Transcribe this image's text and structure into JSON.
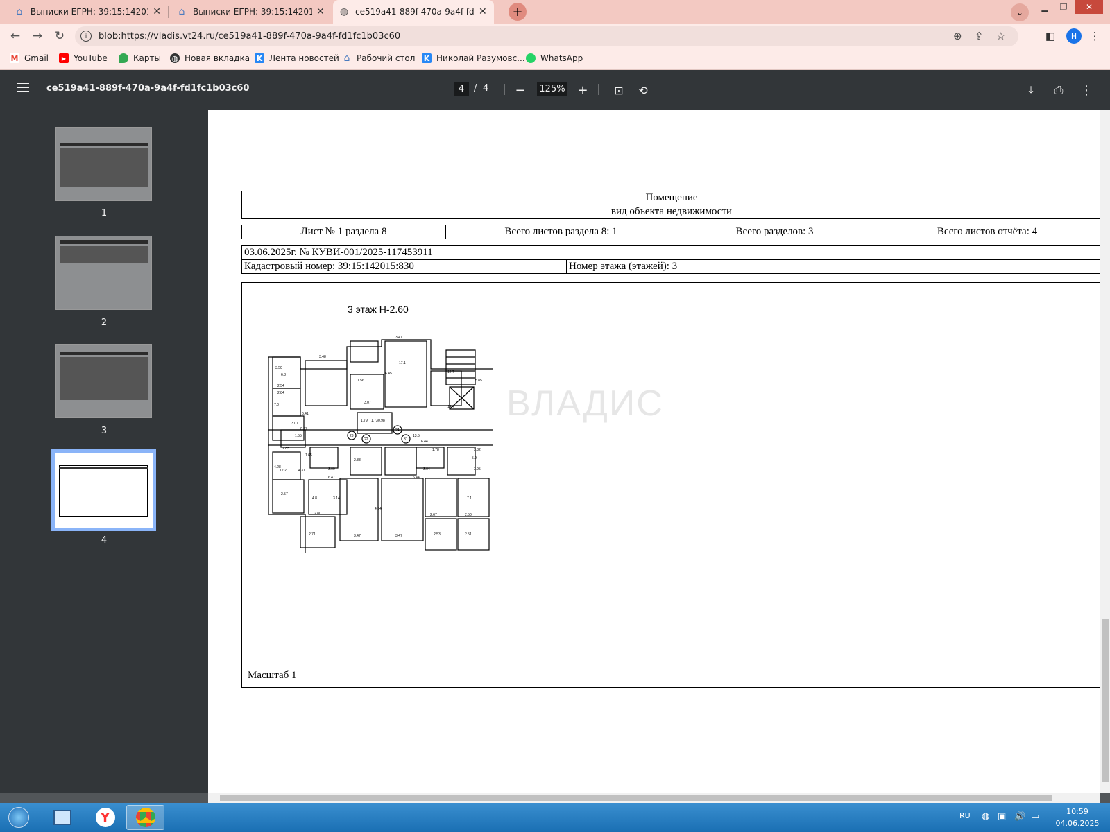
{
  "browser": {
    "tabs": [
      {
        "title": "Выписки ЕГРН: 39:15:142015:830",
        "close": "✕",
        "active": false
      },
      {
        "title": "Выписки ЕГРН: 39:15:142015:830",
        "close": "✕",
        "active": false
      },
      {
        "title": "ce519a41-889f-470a-9a4f-fd1fc1b03c60",
        "close": "✕",
        "active": true
      }
    ],
    "new_tab": "+",
    "url": "blob:https://vladis.vt24.ru/ce519a41-889f-470a-9a4f-fd1fc1b03c60",
    "profile_initial": "Н",
    "bookmarks": [
      {
        "label": "Gmail",
        "icon": "gmail-icon",
        "color": "#ea4335",
        "glyph": "M"
      },
      {
        "label": "YouTube",
        "icon": "youtube-icon",
        "color": "#ff0000",
        "glyph": "▶"
      },
      {
        "label": "Карты",
        "icon": "maps-icon",
        "color": "#34a853",
        "glyph": "●"
      },
      {
        "label": "Новая вкладка",
        "icon": "globe-icon",
        "color": "#444444",
        "glyph": "◍"
      },
      {
        "label": "Лента новостей",
        "icon": "vk-icon",
        "color": "#2787f5",
        "glyph": "K"
      },
      {
        "label": "Рабочий стол",
        "icon": "home-icon",
        "color": "#4a7bbf",
        "glyph": "⌂"
      },
      {
        "label": "Николай Разумовс...",
        "icon": "vk-icon",
        "color": "#2787f5",
        "glyph": "K"
      },
      {
        "label": "WhatsApp",
        "icon": "whatsapp-icon",
        "color": "#25d366",
        "glyph": "●"
      }
    ]
  },
  "pdf": {
    "filename": "ce519a41-889f-470a-9a4f-fd1fc1b03c60",
    "current_page": "4",
    "page_sep": "/",
    "total_pages": "4",
    "zoom": "125%",
    "thumbnails": [
      "1",
      "2",
      "3",
      "4"
    ],
    "selected_page": 4
  },
  "document": {
    "object_name": "Помещение",
    "object_type": "вид объекта недвижимости",
    "sheet": "Лист № 1 раздела 8",
    "sheets_in_section": "Всего листов раздела 8: 1",
    "sections": "Всего разделов: 3",
    "sheets_in_report": "Всего листов отчёта: 4",
    "date_number": "03.06.2025г. № КУВИ-001/2025-117453911",
    "cadastral": "Кадастровый номер: 39:15:142015:830",
    "floor": "Номер этажа (этажей): 3",
    "floor_plan_title": "3 этаж Н-2.60",
    "scale": "Масштаб 1",
    "watermark": "ВЛАДИС"
  },
  "floorplan": {
    "labels": [
      "3.47",
      "3.48",
      "2.54",
      "2.84",
      "7.0",
      "3.50",
      "1.56",
      "5.85",
      "6.45",
      "3.07",
      "3.07",
      "6.41",
      "1.79",
      "1.73",
      "0.98",
      "0.97",
      "1.55",
      "23",
      "22",
      "24",
      "31",
      "6.44",
      "2.85",
      "1.65",
      "3.09",
      "3.95",
      "2.88",
      "3.04",
      "1.78",
      "3.82",
      "6.47",
      "6.44",
      "2.57",
      "3.14",
      "4.94",
      "2.80",
      "2.67",
      "2.50",
      "2.71",
      "3.47",
      "3.47",
      "2.53",
      "2.51",
      "4.28",
      "4.31",
      "13.5",
      "14.7",
      "14.4",
      "17.1",
      "12.2",
      "6.8",
      "5.9",
      "4.8",
      "7.1"
    ]
  },
  "taskbar": {
    "lang": "RU",
    "time": "10:59",
    "date": "04.06.2025"
  },
  "colors": {
    "tabbar": "#f3c9c2",
    "toolbar": "#fdebe8",
    "pdf_toolbar": "#323639",
    "viewer_bg": "#525659",
    "taskbar": "#1a6fb3"
  }
}
